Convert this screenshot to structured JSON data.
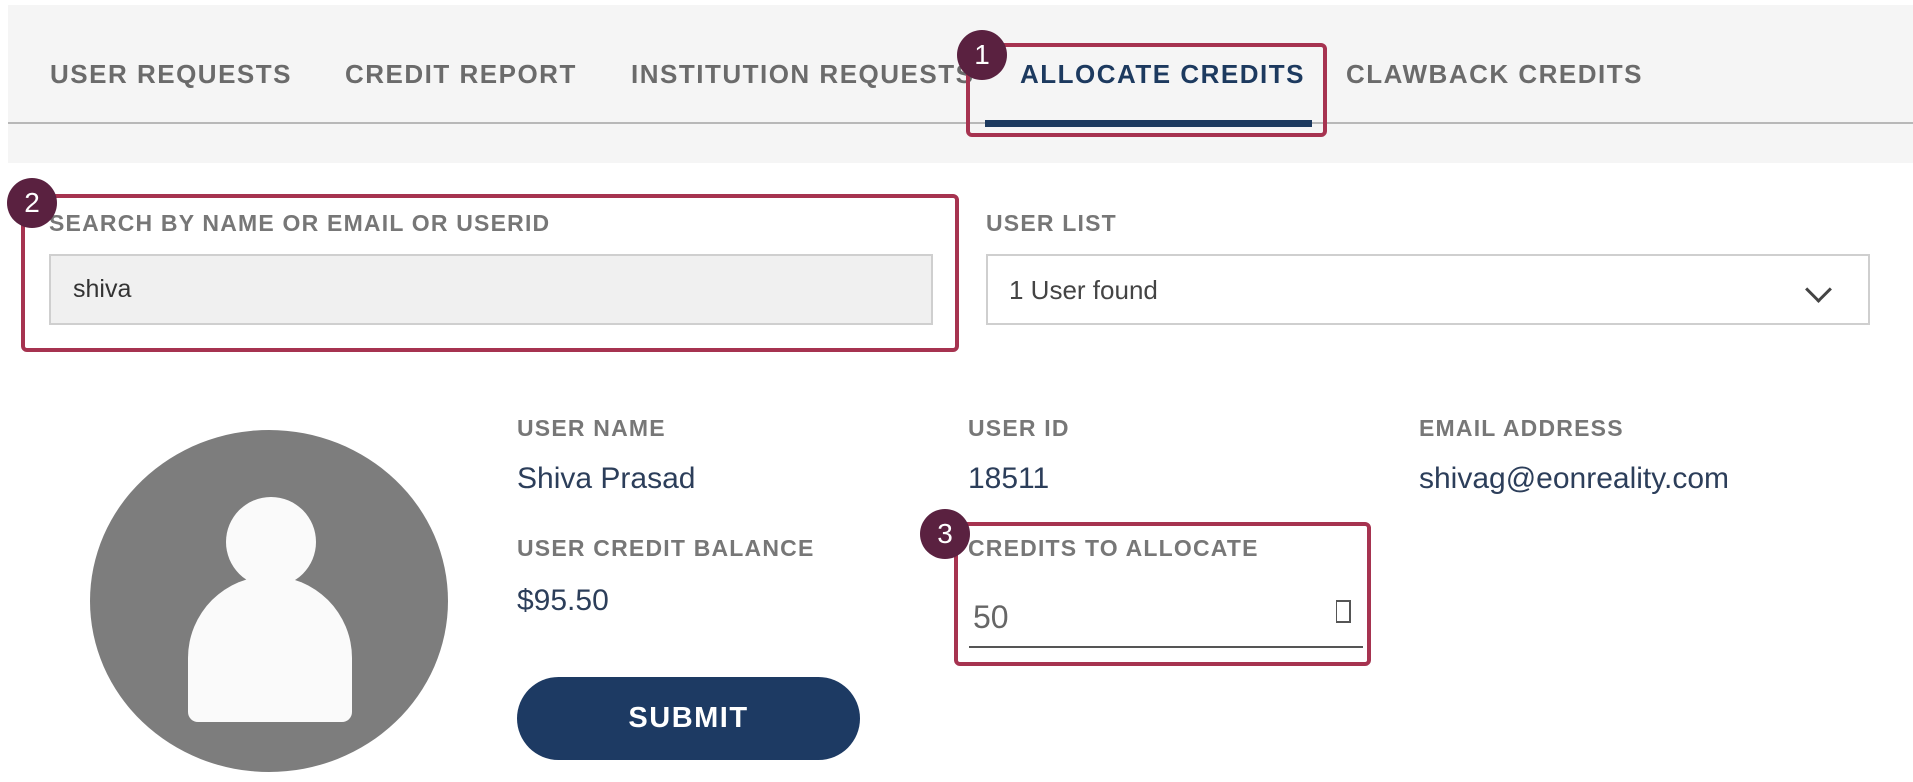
{
  "tabs": [
    {
      "label": "USER REQUESTS",
      "active": false
    },
    {
      "label": "CREDIT REPORT",
      "active": false
    },
    {
      "label": "INSTITUTION REQUESTS",
      "active": false
    },
    {
      "label": "ALLOCATE CREDITS",
      "active": true
    },
    {
      "label": "CLAWBACK CREDITS",
      "active": false
    }
  ],
  "callouts": [
    "1",
    "2",
    "3"
  ],
  "search": {
    "label": "SEARCH BY NAME OR EMAIL OR USERID",
    "value": "shiva"
  },
  "user_list": {
    "label": "USER LIST",
    "selected": "1 User found"
  },
  "user": {
    "name_label": "USER NAME",
    "name": "Shiva Prasad",
    "id_label": "USER ID",
    "id": "18511",
    "email_label": "EMAIL ADDRESS",
    "email": "shivag@eonreality.com",
    "balance_label": "USER CREDIT BALANCE",
    "balance": "$95.50"
  },
  "allocate": {
    "label": "CREDITS TO ALLOCATE",
    "value": "50"
  },
  "submit_label": "SUBMIT",
  "colors": {
    "accent": "#1d3a63",
    "callout": "#a63350",
    "badge": "#5a2140"
  },
  "icons": {
    "avatar": "user-avatar-icon",
    "dropdown": "chevron-down-icon",
    "spinner": "number-spinner-icon"
  }
}
